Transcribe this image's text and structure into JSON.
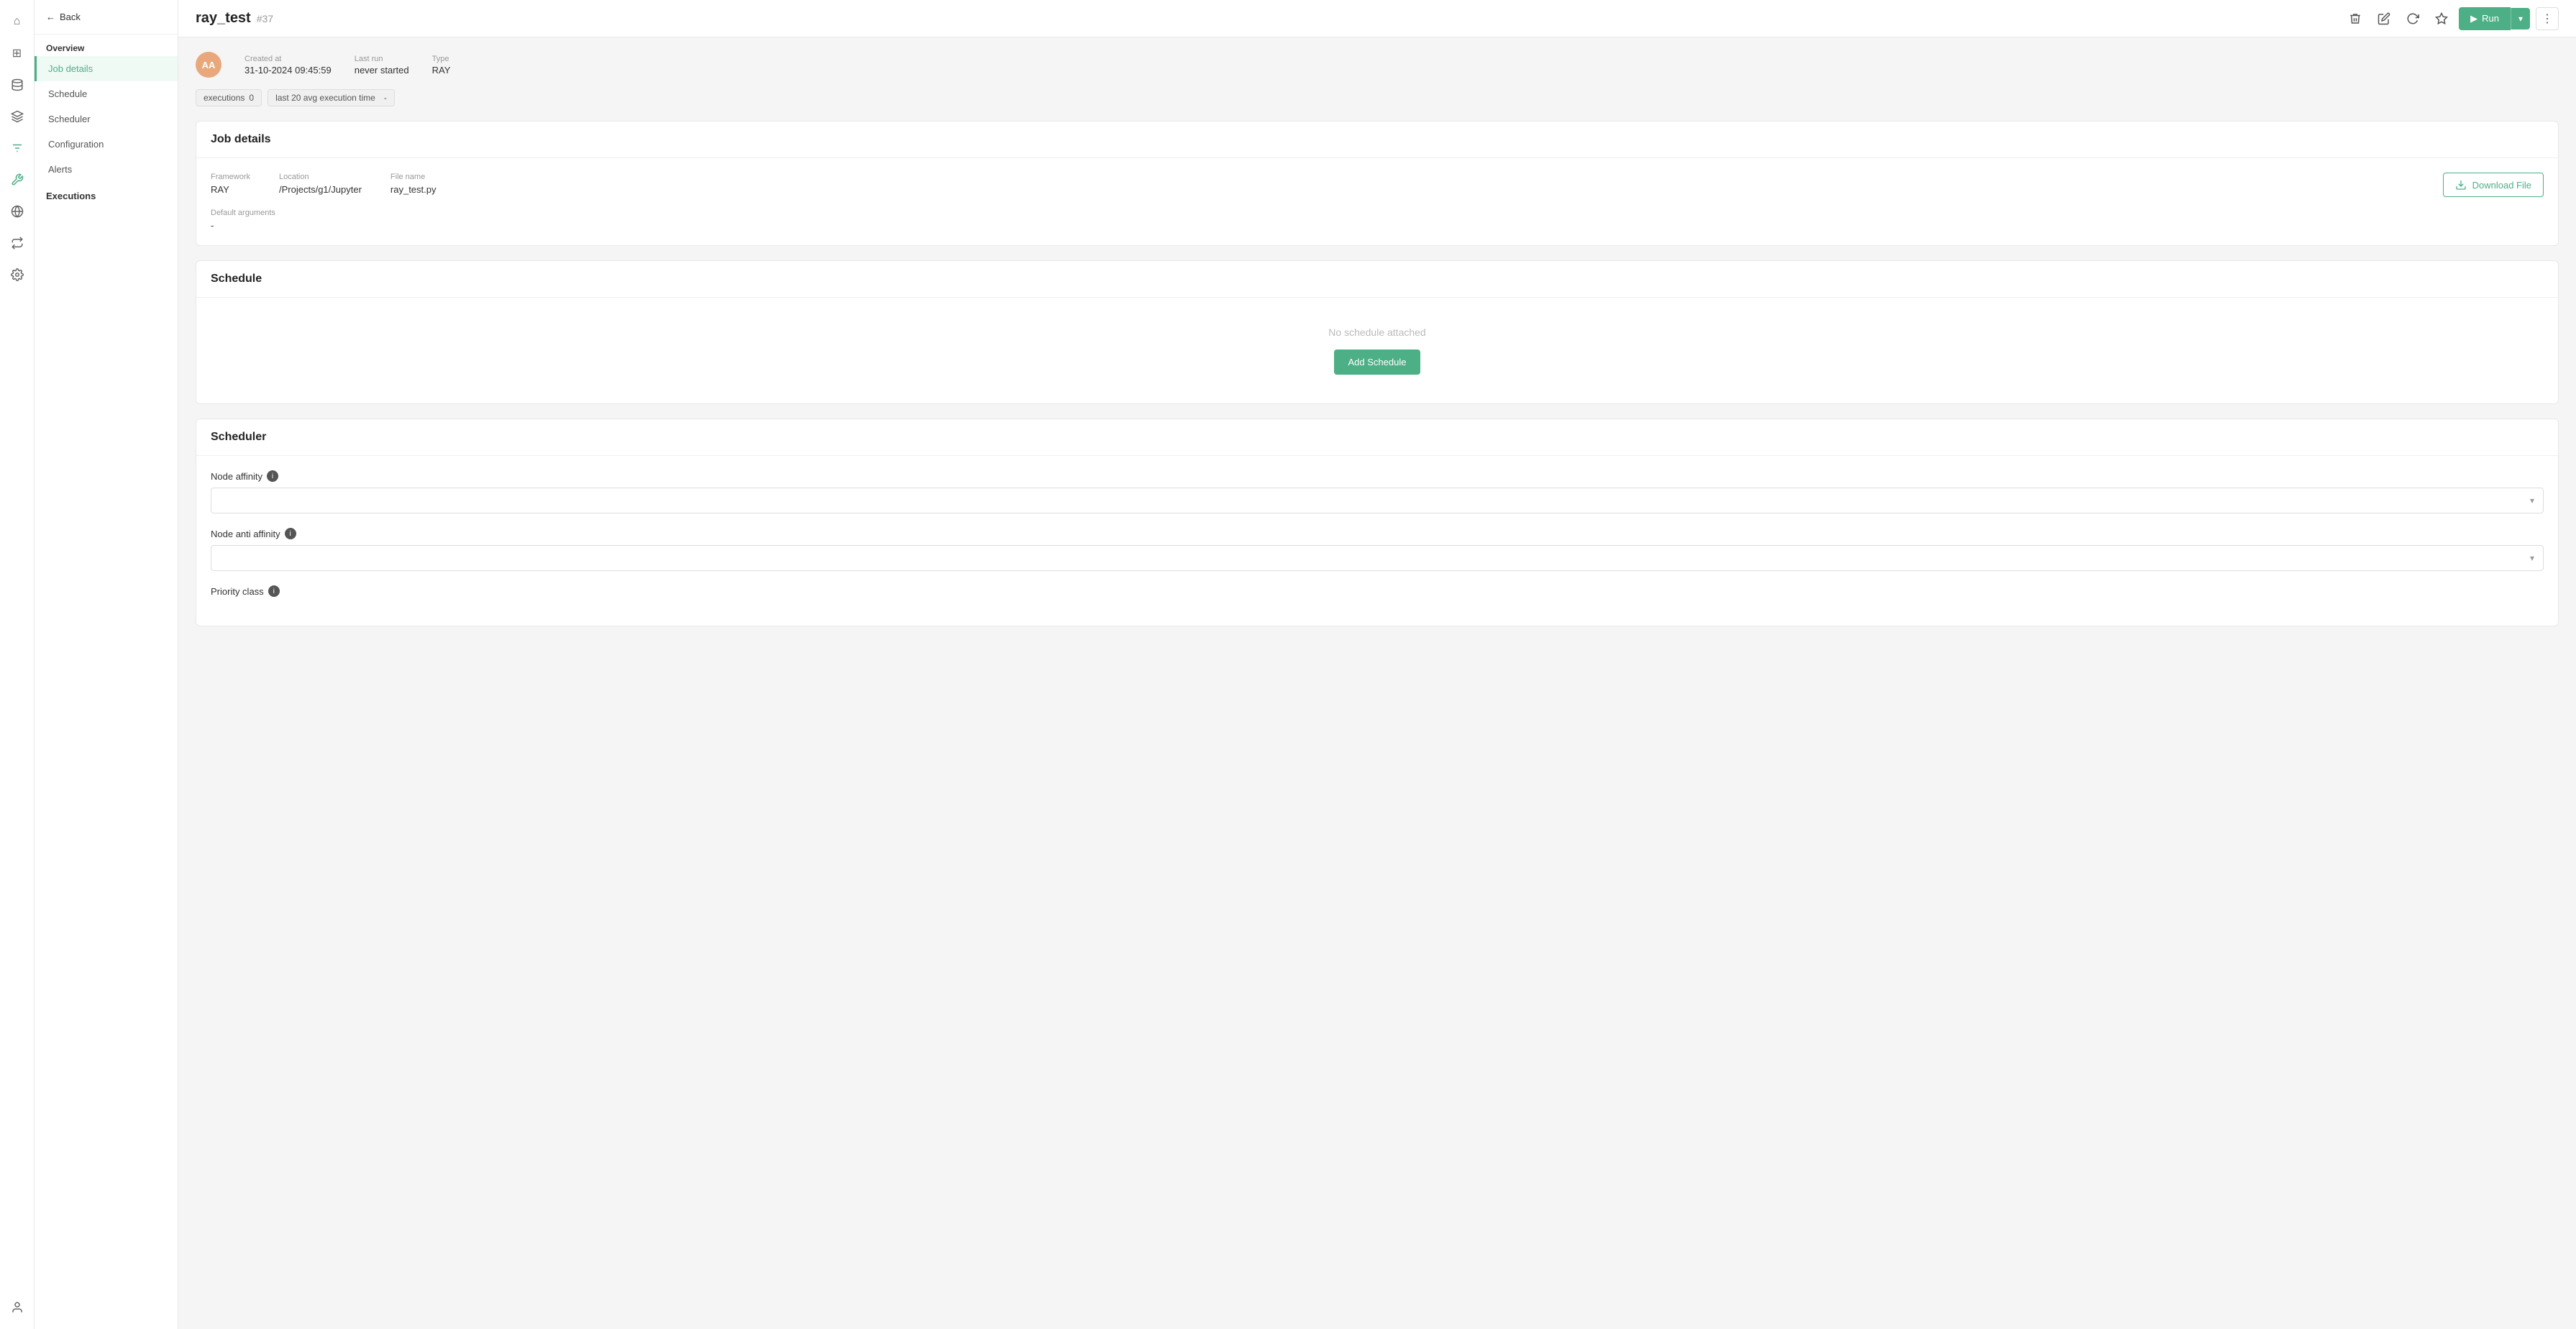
{
  "iconBar": {
    "items": [
      {
        "name": "home-icon",
        "symbol": "⌂",
        "active": false
      },
      {
        "name": "grid-icon",
        "symbol": "⊞",
        "active": false
      },
      {
        "name": "database-icon",
        "symbol": "🗄",
        "active": false
      },
      {
        "name": "layers-icon",
        "symbol": "≡",
        "active": false
      },
      {
        "name": "filter-icon",
        "symbol": "⚙",
        "active": false
      },
      {
        "name": "tool-icon",
        "symbol": "🔧",
        "active": true
      },
      {
        "name": "share-icon",
        "symbol": "⇄",
        "active": false
      },
      {
        "name": "network-icon",
        "symbol": "⬡",
        "active": false
      },
      {
        "name": "flow-icon",
        "symbol": "⇆",
        "active": false
      },
      {
        "name": "settings-icon",
        "symbol": "⚙",
        "active": false
      }
    ],
    "bottomItem": {
      "name": "user-icon",
      "symbol": "👤"
    }
  },
  "sidebar": {
    "back_label": "Back",
    "overview_label": "Overview",
    "nav_items": [
      {
        "label": "Job details",
        "active": true
      },
      {
        "label": "Schedule",
        "active": false
      },
      {
        "label": "Scheduler",
        "active": false
      },
      {
        "label": "Configuration",
        "active": false
      },
      {
        "label": "Alerts",
        "active": false
      }
    ],
    "executions_label": "Executions"
  },
  "topbar": {
    "title": "ray_test",
    "id": "#37",
    "run_label": "Run",
    "actions": {
      "delete_title": "delete",
      "edit_title": "edit",
      "refresh_title": "refresh",
      "pin_title": "pin"
    }
  },
  "meta": {
    "avatar_text": "AA",
    "created_at_label": "Created at",
    "created_at_value": "31-10-2024 09:45:59",
    "last_run_label": "Last run",
    "last_run_value": "never started",
    "type_label": "Type",
    "type_value": "RAY"
  },
  "filters": {
    "executions_label": "executions",
    "executions_count": "0",
    "avg_label": "last 20 avg execution time",
    "avg_value": "-"
  },
  "jobDetails": {
    "section_title": "Job details",
    "framework_label": "Framework",
    "framework_value": "RAY",
    "location_label": "Location",
    "location_value": "/Projects/g1/Jupyter",
    "file_name_label": "File name",
    "file_name_value": "ray_test.py",
    "download_label": "Download File",
    "default_args_label": "Default arguments",
    "default_args_value": "-"
  },
  "schedule": {
    "section_title": "Schedule",
    "empty_text": "No schedule attached",
    "add_button_label": "Add Schedule"
  },
  "scheduler": {
    "section_title": "Scheduler",
    "node_affinity_label": "Node affinity",
    "node_affinity_info": "i",
    "node_affinity_placeholder": "",
    "node_anti_affinity_label": "Node anti affinity",
    "node_anti_affinity_info": "i",
    "node_anti_affinity_placeholder": "",
    "priority_class_label": "Priority class",
    "priority_class_info": "i"
  },
  "colors": {
    "green": "#4caf85",
    "green_light": "#f0faf5",
    "border": "#e8e8e8",
    "text_dark": "#222",
    "text_muted": "#999"
  }
}
